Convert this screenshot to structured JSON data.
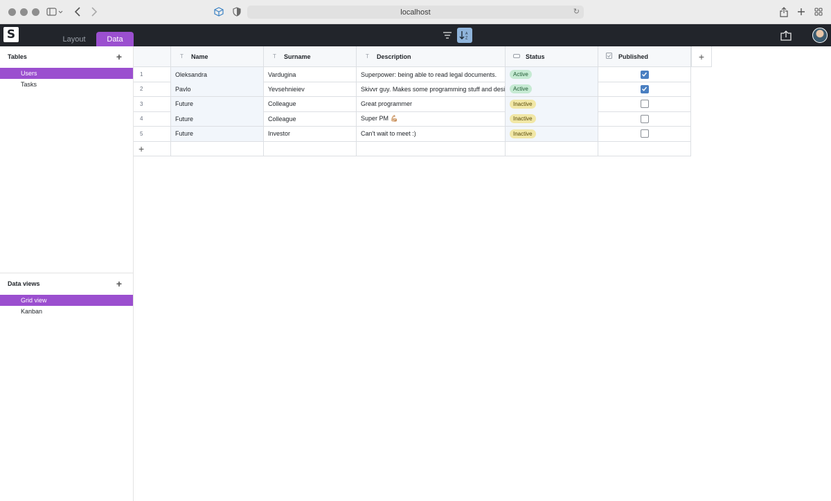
{
  "browser": {
    "url": "localhost"
  },
  "app": {
    "logo_letter": "S",
    "tabs": [
      {
        "label": "Layout",
        "active": false
      },
      {
        "label": "Data",
        "active": true
      }
    ],
    "accent": "#9b4fcf"
  },
  "sidebar": {
    "tables_heading": "Tables",
    "tables": [
      {
        "label": "Users",
        "active": true
      },
      {
        "label": "Tasks",
        "active": false
      }
    ],
    "views_heading": "Data views",
    "views": [
      {
        "label": "Grid view",
        "active": true
      },
      {
        "label": "Kanban",
        "active": false
      }
    ]
  },
  "grid": {
    "columns": [
      {
        "label": "Name",
        "type_icon": "T"
      },
      {
        "label": "Surname",
        "type_icon": "T"
      },
      {
        "label": "Description",
        "type_icon": "T"
      },
      {
        "label": "Status",
        "type_icon": "select"
      },
      {
        "label": "Published",
        "type_icon": "checkbox"
      }
    ],
    "rows": [
      {
        "num": "1",
        "name": "Oleksandra",
        "surname": "Vardugina",
        "description": "Superpower: being able to read legal documents.",
        "status": "Active",
        "published": true
      },
      {
        "num": "2",
        "name": "Pavlo",
        "surname": "Yevsehnieiev",
        "description": "Skivvr guy. Makes some programming stuff and designs.",
        "status": "Active",
        "published": true
      },
      {
        "num": "3",
        "name": "Future",
        "surname": "Colleague",
        "description": "Great programmer",
        "status": "Inactive",
        "published": false
      },
      {
        "num": "4",
        "name": "Future",
        "surname": "Colleague",
        "description": "Super PM  💪🏼",
        "status": "Inactive",
        "published": false
      },
      {
        "num": "5",
        "name": "Future",
        "surname": "Investor",
        "description": "Can't wait to meet :)",
        "status": "Inactive",
        "published": false
      }
    ],
    "status_colors": {
      "Active": "#c6ead3",
      "Inactive": "#f1e7a6"
    }
  }
}
